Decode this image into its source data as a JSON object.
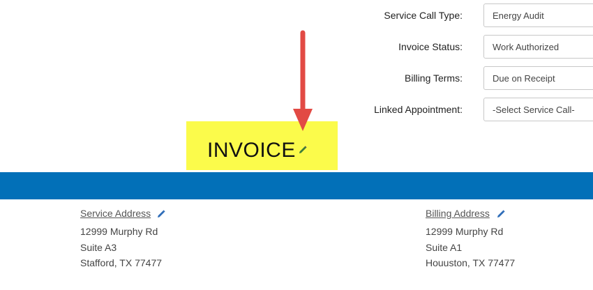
{
  "form": {
    "service_call_type": {
      "label": "Service Call Type:",
      "value": "Energy Audit"
    },
    "invoice_status": {
      "label": "Invoice Status:",
      "value": "Work Authorized"
    },
    "billing_terms": {
      "label": "Billing Terms:",
      "value": "Due on Receipt"
    },
    "linked_appointment": {
      "label": "Linked Appointment:",
      "value": "-Select Service Call-"
    }
  },
  "invoice": {
    "title": "INVOICE",
    "edit_icon": "pencil-icon"
  },
  "annotation": {
    "arrow_color": "#e24a44",
    "highlight_color": "#fbfb4b"
  },
  "header_bar": {
    "color": "#0270b8"
  },
  "service_address": {
    "heading": "Service Address",
    "lines": [
      "12999 Murphy Rd",
      "Suite A3",
      "Stafford, TX 77477"
    ],
    "edit_icon": "pencil-icon"
  },
  "billing_address": {
    "heading": "Billing Address",
    "lines": [
      "12999 Murphy Rd",
      "Suite A1",
      "Houuston, TX 77477"
    ],
    "edit_icon": "pencil-icon"
  }
}
